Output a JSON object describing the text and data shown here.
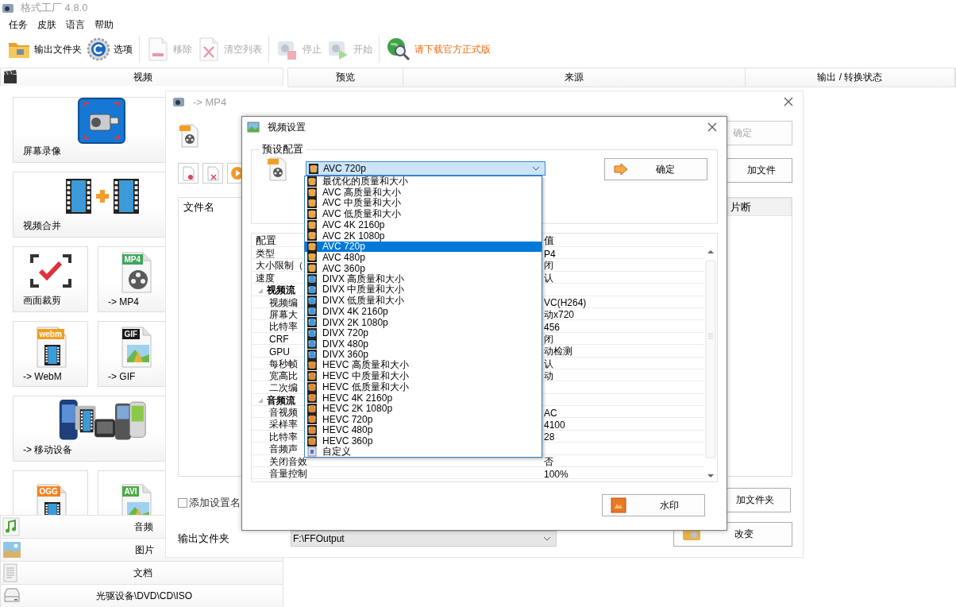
{
  "window": {
    "title": "格式工厂 4.8.0"
  },
  "menu": [
    "任务",
    "皮肤",
    "语言",
    "帮助"
  ],
  "toolbar": [
    {
      "label": "输出文件夹",
      "kind": "folder",
      "disabled": false
    },
    {
      "label": "选项",
      "kind": "gear",
      "disabled": false
    },
    {
      "label": "移除",
      "kind": "remove",
      "disabled": true
    },
    {
      "label": "清空列表",
      "kind": "clear",
      "disabled": true
    },
    {
      "label": "停止",
      "kind": "stop",
      "disabled": true
    },
    {
      "label": "开始",
      "kind": "start",
      "disabled": true
    },
    {
      "label": "请下载官方正式版",
      "kind": "link",
      "disabled": false
    }
  ],
  "sidebar": {
    "categories": [
      {
        "label": "视频",
        "kind": "video",
        "tiles": [
          {
            "label": "屏幕录像",
            "kind": "record"
          },
          {
            "label": "视频合并",
            "kind": "merge"
          },
          {
            "label": "画面裁剪",
            "kind": "crop"
          },
          {
            "label": "-> MP4",
            "kind": "reel",
            "badge": "MP4",
            "color": "#3fa45c"
          },
          {
            "label": "-> WebM",
            "kind": "film",
            "badge": "webm",
            "color": "#f0a020"
          },
          {
            "label": "-> GIF",
            "kind": "picture",
            "badge": "GIF",
            "color": "#1a1a1a"
          },
          {
            "label": "-> 移动设备",
            "kind": "mobile"
          },
          {
            "kind": "film",
            "badge": "OGG",
            "color": "#f5841f"
          },
          {
            "kind": "picture",
            "badge": "AVI",
            "color": "#4ea845"
          }
        ]
      },
      {
        "label": "音频",
        "kind": "audio"
      },
      {
        "label": "图片",
        "kind": "image"
      },
      {
        "label": "文档",
        "kind": "document"
      },
      {
        "label": "光驱设备\\DVD\\CD\\ISO",
        "kind": "disc"
      }
    ]
  },
  "task_list": {
    "columns": [
      "预览",
      "来源",
      "输出 / 转换状态"
    ]
  },
  "convert_dialog": {
    "title": "-> MP4",
    "ok_button": {
      "label": "确定",
      "disabled": true
    },
    "add_file_button": "加文件",
    "columns": [
      "文件名",
      "片断"
    ],
    "add_folder_button": "加文件夹",
    "add_name_checkbox": {
      "label": "添加设置名",
      "checked": false
    },
    "output_folder": {
      "label": "输出文件夹",
      "value": "F:\\FFOutput"
    },
    "change_button": "改变"
  },
  "settings_dialog": {
    "title": "视频设置",
    "preset_group": "预设配置",
    "preset": {
      "value": "AVC 720p",
      "kind": "avc"
    },
    "ok_button": "确定",
    "properties": {
      "columns": [
        "配置",
        "值"
      ],
      "rows": [
        {
          "name": "类型",
          "value": "P4"
        },
        {
          "name": "大小限制（",
          "value": "闭"
        },
        {
          "name": "速度",
          "value": "认"
        },
        {
          "name": "视频流",
          "expanded": true,
          "children": [
            {
              "name": "视频编",
              "value": "VC(H264)"
            },
            {
              "name": "屏幕大",
              "value": "动x720"
            },
            {
              "name": "比特率",
              "value": "456"
            },
            {
              "name": "CRF",
              "value": "闭"
            },
            {
              "name": "GPU",
              "value": "动检测"
            },
            {
              "name": "每秒帧",
              "value": "认"
            },
            {
              "name": "宽高比",
              "value": "动"
            },
            {
              "name": "二次编"
            }
          ]
        },
        {
          "name": "音频流",
          "expanded": true,
          "children": [
            {
              "name": "音视频",
              "value": "AC"
            },
            {
              "name": "采样率",
              "value": "4100"
            },
            {
              "name": "比特率",
              "value": "28"
            },
            {
              "name": "音频声"
            },
            {
              "name": "关闭音效",
              "value": "否"
            },
            {
              "name": "音量控制",
              "value": "100%"
            }
          ]
        }
      ]
    },
    "watermark_button": "水印"
  },
  "preset_list": [
    {
      "label": "最优化的质量和大小",
      "kind": "avc",
      "selected": false
    },
    {
      "label": "AVC 高质量和大小",
      "kind": "avc",
      "selected": false
    },
    {
      "label": "AVC 中质量和大小",
      "kind": "avc",
      "selected": false
    },
    {
      "label": "AVC 低质量和大小",
      "kind": "avc",
      "selected": false
    },
    {
      "label": "AVC 4K 2160p",
      "kind": "avc",
      "selected": false
    },
    {
      "label": "AVC 2K 1080p",
      "kind": "avc",
      "selected": false
    },
    {
      "label": "AVC 720p",
      "kind": "avc",
      "selected": true
    },
    {
      "label": "AVC 480p",
      "kind": "avc",
      "selected": false
    },
    {
      "label": "AVC 360p",
      "kind": "avc",
      "selected": false
    },
    {
      "label": "DIVX 高质量和大小",
      "kind": "divx",
      "selected": false
    },
    {
      "label": "DIVX 中质量和大小",
      "kind": "divx",
      "selected": false
    },
    {
      "label": "DIVX 低质量和大小",
      "kind": "divx",
      "selected": false
    },
    {
      "label": "DIVX 4K 2160p",
      "kind": "divx",
      "selected": false
    },
    {
      "label": "DIVX 2K 1080p",
      "kind": "divx",
      "selected": false
    },
    {
      "label": "DIVX 720p",
      "kind": "divx",
      "selected": false
    },
    {
      "label": "DIVX 480p",
      "kind": "divx",
      "selected": false
    },
    {
      "label": "DIVX 360p",
      "kind": "divx",
      "selected": false
    },
    {
      "label": "HEVC 高质量和大小",
      "kind": "hevc",
      "selected": false
    },
    {
      "label": "HEVC 中质量和大小",
      "kind": "hevc",
      "selected": false
    },
    {
      "label": "HEVC 低质量和大小",
      "kind": "hevc",
      "selected": false
    },
    {
      "label": "HEVC 4K 2160p",
      "kind": "hevc",
      "selected": false
    },
    {
      "label": "HEVC 2K 1080p",
      "kind": "hevc",
      "selected": false
    },
    {
      "label": "HEVC 720p",
      "kind": "hevc",
      "selected": false
    },
    {
      "label": "HEVC 480p",
      "kind": "hevc",
      "selected": false
    },
    {
      "label": "HEVC 360p",
      "kind": "hevc",
      "selected": false
    },
    {
      "label": "自定义",
      "kind": "custom",
      "selected": false
    }
  ]
}
